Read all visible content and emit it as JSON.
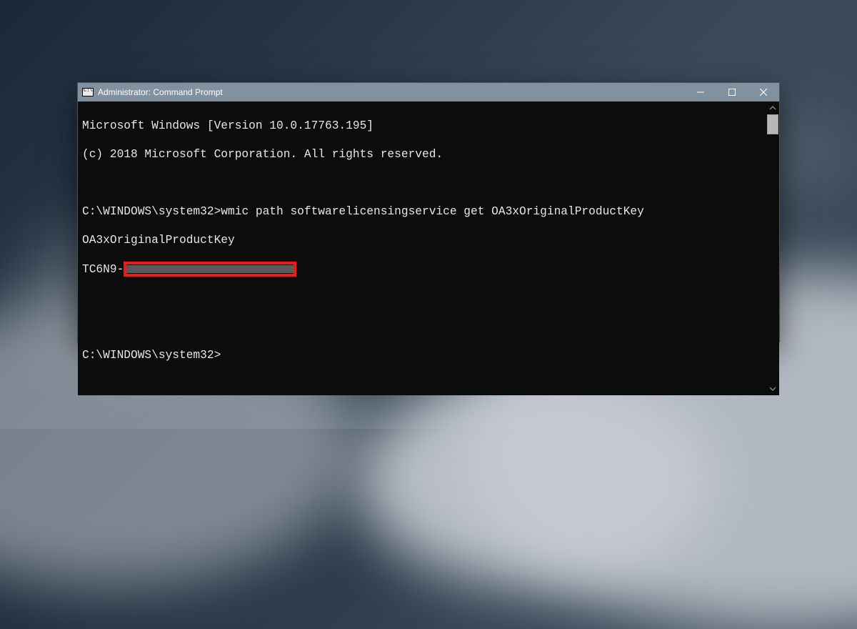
{
  "window": {
    "title": "Administrator: Command Prompt"
  },
  "output": {
    "banner_line1": "Microsoft Windows [Version 10.0.17763.195]",
    "banner_line2": "(c) 2018 Microsoft Corporation. All rights reserved.",
    "prompt": "C:\\WINDOWS\\system32>",
    "command": "wmic path softwarelicensingservice get OA3xOriginalProductKey",
    "result_header": "OA3xOriginalProductKey",
    "key_prefix": "TC6N9-"
  }
}
